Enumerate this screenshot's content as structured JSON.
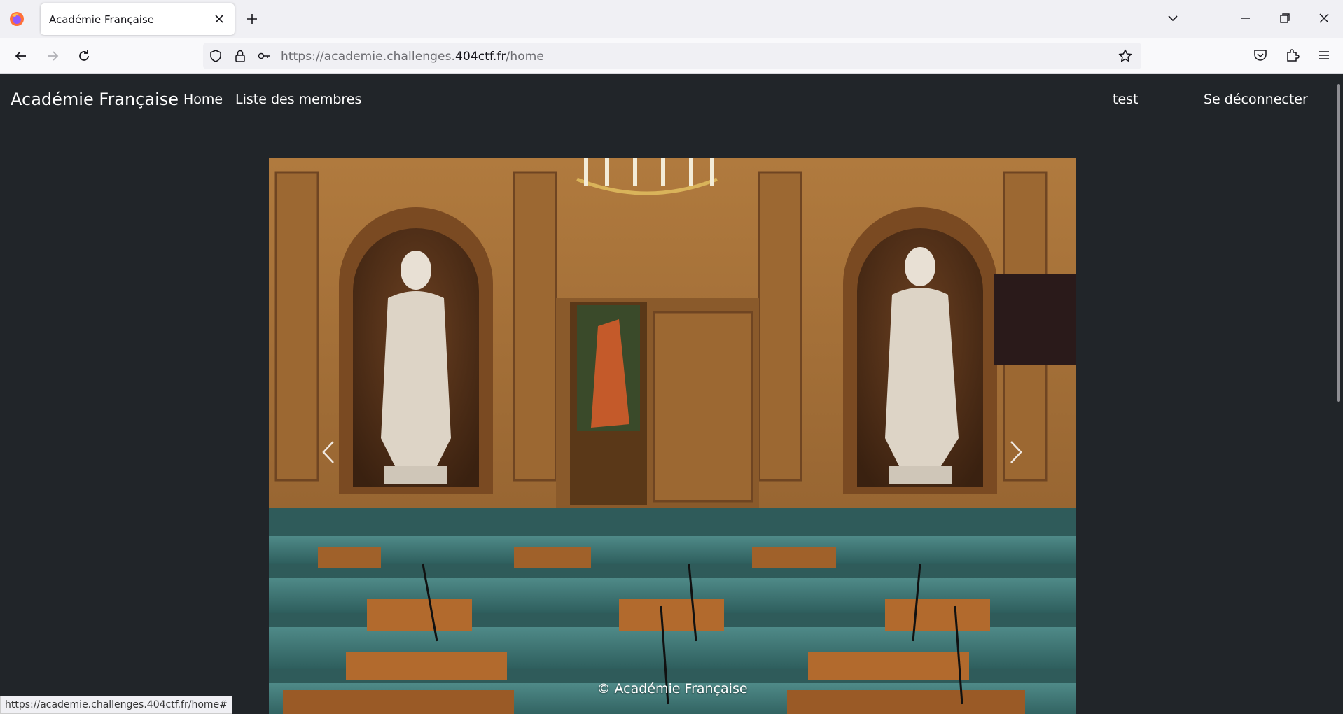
{
  "browser": {
    "tab_title": "Académie Française",
    "url": {
      "prefix": "https://academie.challenges.",
      "domain": "404ctf.fr",
      "path": "/home"
    },
    "status_url": "https://academie.challenges.404ctf.fr/home#"
  },
  "site": {
    "brand": "Académie Française",
    "nav": [
      {
        "label": "Home"
      },
      {
        "label": "Liste des membres"
      }
    ],
    "user": "test",
    "logout": "Se déconnecter"
  },
  "carousel": {
    "caption": "© Académie Française"
  },
  "icons": {
    "firefox": "firefox-logo-icon",
    "close": "close-icon",
    "new_tab": "plus-icon",
    "back": "arrow-left-icon",
    "forward": "arrow-right-icon",
    "reload": "reload-icon",
    "shield": "shield-icon",
    "lock": "lock-icon",
    "key": "key-icon",
    "bookmark": "star-icon",
    "pocket": "pocket-icon",
    "extensions": "puzzle-icon",
    "menu": "hamburger-icon",
    "prev": "chevron-left-icon",
    "next": "chevron-right-icon"
  },
  "colors": {
    "page_bg": "#212529",
    "chrome_bg": "#f0f0f4",
    "text_light": "#ffffff"
  }
}
